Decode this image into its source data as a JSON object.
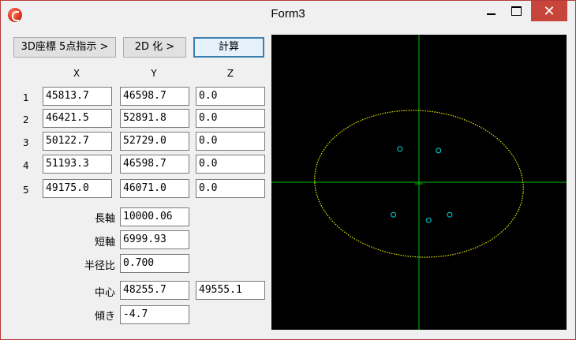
{
  "window": {
    "title": "Form3",
    "close_glyph": "✕"
  },
  "toolbar": {
    "points_button": "3D座標 5点指示 >",
    "to2d_button": "2D 化 >",
    "calc_button": "計算"
  },
  "table": {
    "headers": [
      "X",
      "Y",
      "Z"
    ],
    "rows": [
      {
        "n": "1",
        "x": "45813.7",
        "y": "46598.7",
        "z": "0.0"
      },
      {
        "n": "2",
        "x": "46421.5",
        "y": "52891.8",
        "z": "0.0"
      },
      {
        "n": "3",
        "x": "50122.7",
        "y": "52729.0",
        "z": "0.0"
      },
      {
        "n": "4",
        "x": "51193.3",
        "y": "46598.7",
        "z": "0.0"
      },
      {
        "n": "5",
        "x": "49175.0",
        "y": "46071.0",
        "z": "0.0"
      }
    ]
  },
  "results": {
    "major_label": "長軸",
    "major_value": "10000.06",
    "minor_label": "短軸",
    "minor_value": "6999.93",
    "ratio_label": "半径比",
    "ratio_value": "0.700",
    "center_label": "中心",
    "center_x": "48255.7",
    "center_y": "49555.1",
    "tilt_label": "傾き",
    "tilt_value": "-4.7"
  },
  "plot": {
    "background": "#000000",
    "axis_color": "#00c000",
    "ellipse_color": "#e6e600",
    "point_color": "#00e0e0",
    "ellipse": {
      "rx": 10000.06,
      "ry": 6999.93,
      "tilt_deg": -4.7
    }
  }
}
